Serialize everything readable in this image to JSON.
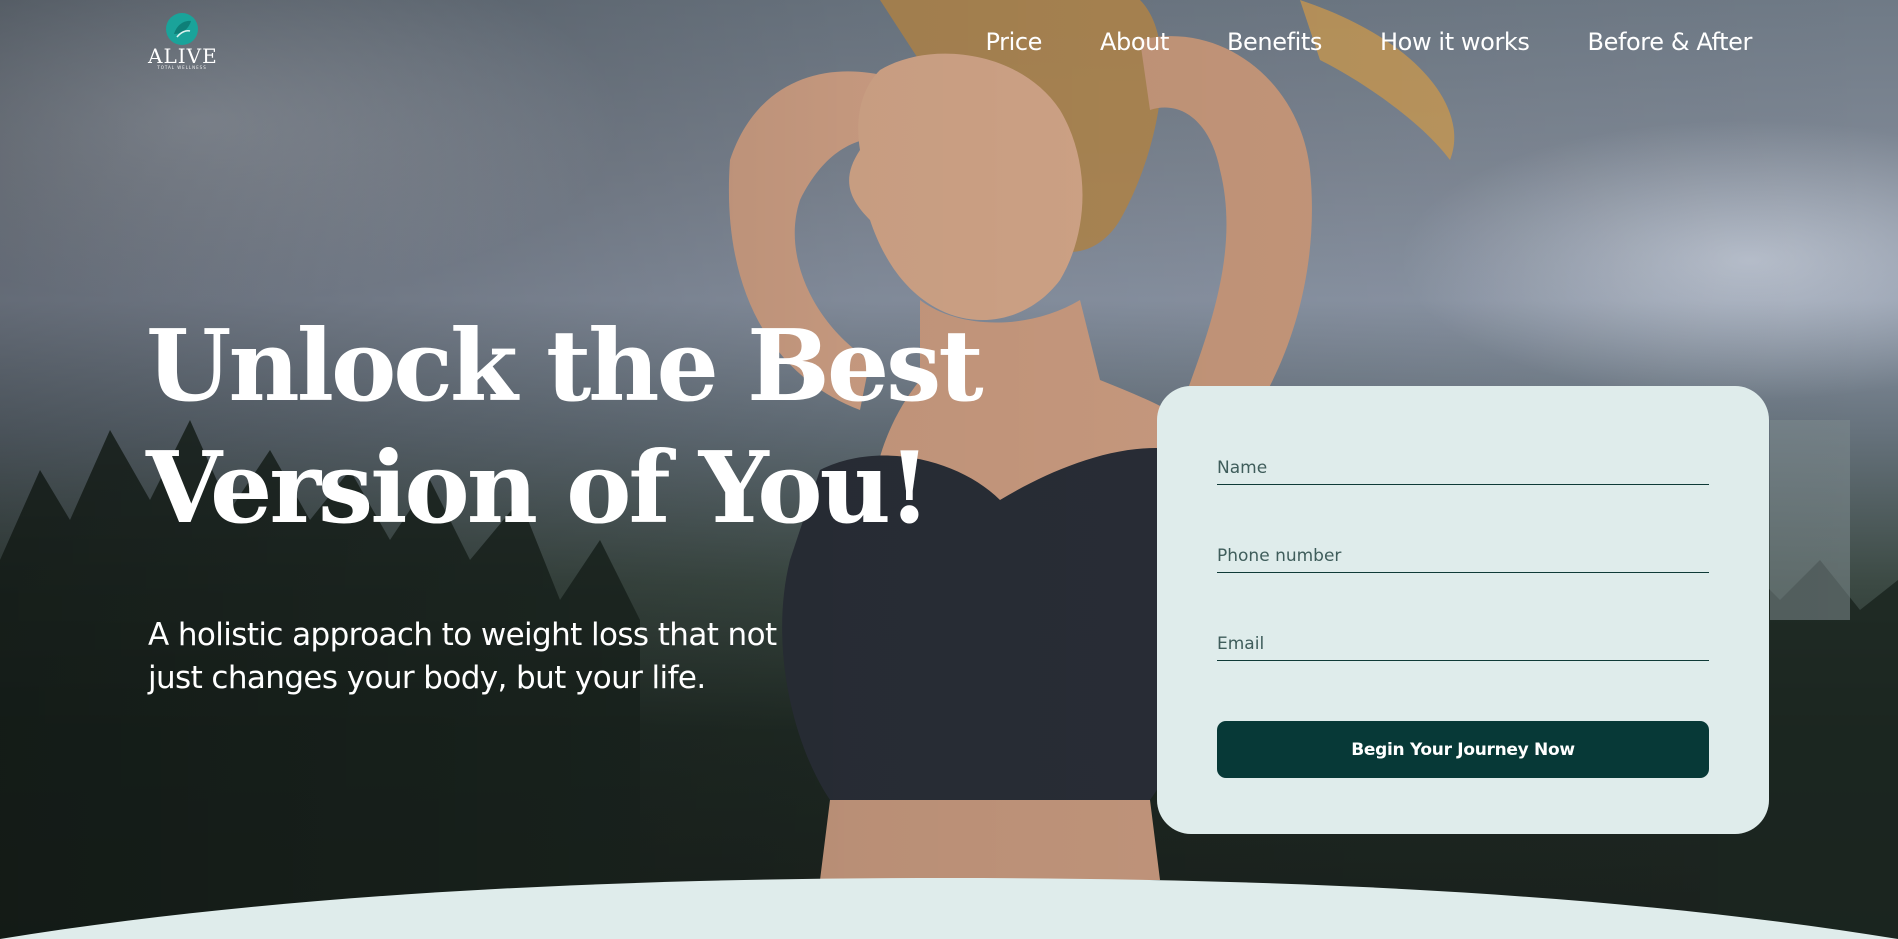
{
  "brand": {
    "name": "ALIVE",
    "tagline": "TOTAL WELLNESS",
    "accent_color": "#1aa39a"
  },
  "nav": {
    "items": [
      {
        "label": "Price"
      },
      {
        "label": "About"
      },
      {
        "label": "Benefits"
      },
      {
        "label": "How it works"
      },
      {
        "label": "Before & After"
      }
    ]
  },
  "hero": {
    "headline_line1": "Unlock the Best",
    "headline_line2": "Version of You!",
    "subheadline": "A holistic approach to weight loss that not just changes your body, but your life."
  },
  "form": {
    "name_placeholder": "Name",
    "phone_placeholder": "Phone number",
    "email_placeholder": "Email",
    "submit_label": "Begin Your Journey Now",
    "card_color": "#dfeceb",
    "button_color": "#073937"
  }
}
